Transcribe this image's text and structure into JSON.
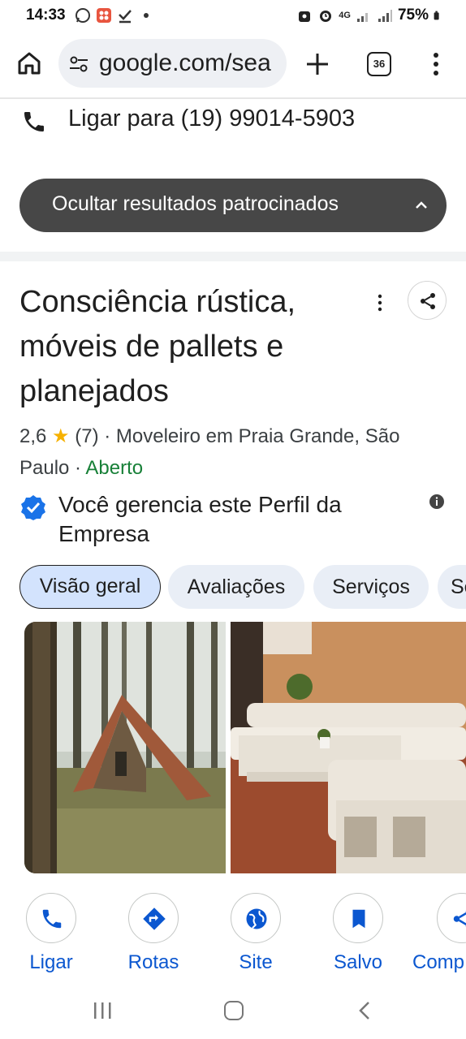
{
  "status_bar": {
    "time": "14:33",
    "battery": "75%",
    "network_label": "4G",
    "icons": [
      "whatsapp-icon",
      "app-icon",
      "check-icon",
      "dot-icon",
      "lock-icon",
      "alarm-icon",
      "signal-icon",
      "signal-icon",
      "battery-icon"
    ]
  },
  "browser": {
    "url": "google.com/sea",
    "tab_count": "36"
  },
  "call": {
    "label": "Ligar para (19) 99014-5903"
  },
  "sponsored": {
    "label": "Ocultar resultados patrocinados"
  },
  "business": {
    "title": "Consciência rústica, móveis de pallets e planejados",
    "rating": "2,6",
    "star": "★",
    "review_count": "(7)",
    "category_location": "· Moveleiro em Praia Grande, São Paulo ·",
    "open_status": "Aberto",
    "verified_text": "Você gerencia este Perfil da Empresa"
  },
  "tabs": [
    {
      "label": "Visão geral",
      "active": true
    },
    {
      "label": "Avaliações",
      "active": false
    },
    {
      "label": "Serviços",
      "active": false
    },
    {
      "label": "Se",
      "active": false
    }
  ],
  "actions": [
    {
      "label": "Ligar",
      "icon": "phone-icon"
    },
    {
      "label": "Rotas",
      "icon": "directions-icon"
    },
    {
      "label": "Site",
      "icon": "globe-icon"
    },
    {
      "label": "Salvo",
      "icon": "bookmark-icon"
    },
    {
      "label": "Comp",
      "icon": "share-icon"
    }
  ],
  "colors": {
    "accent": "#0b57d0",
    "open": "#188038",
    "star": "#f6b100",
    "chip": "#e9eef6",
    "chip_active": "#d3e3fd",
    "sponsored_bg": "#474747"
  }
}
